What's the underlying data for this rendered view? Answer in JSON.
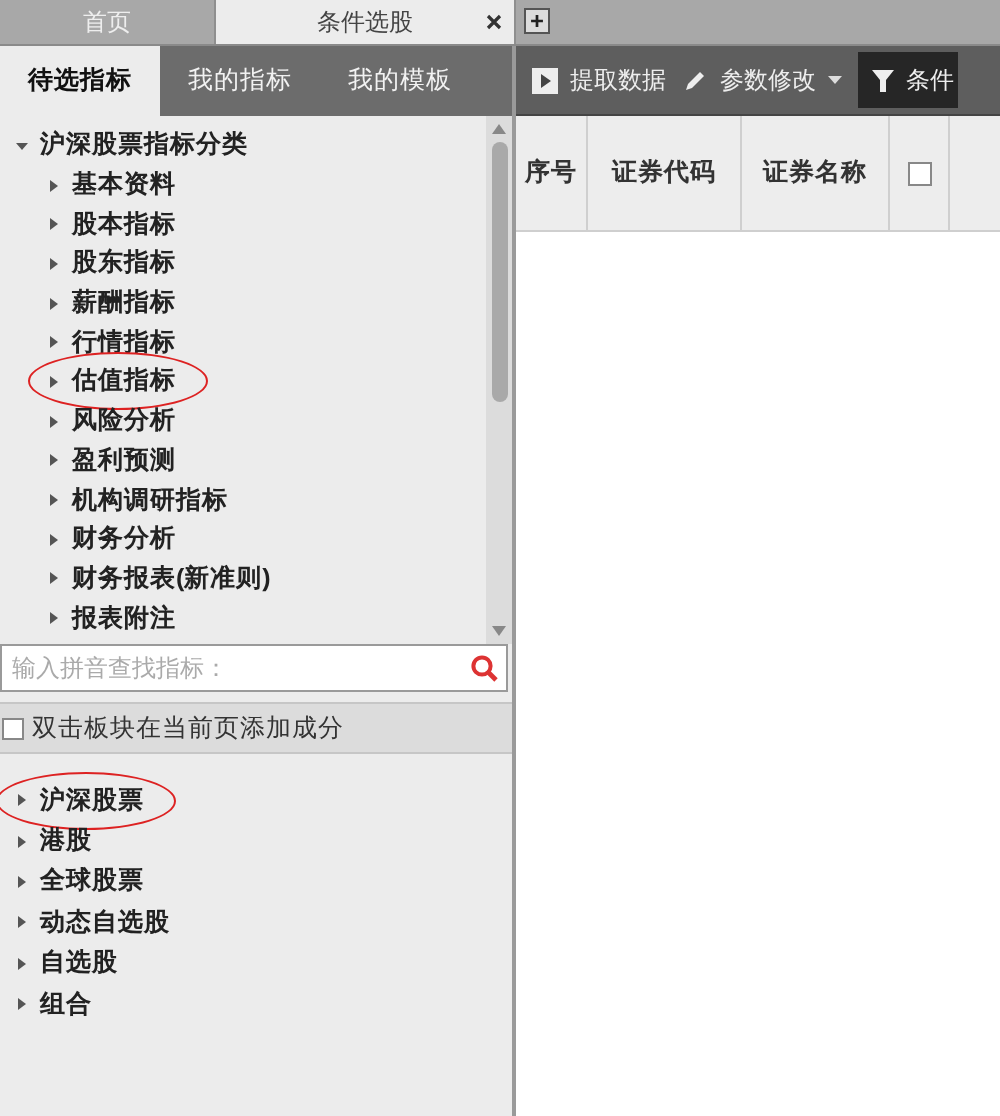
{
  "tabs": [
    {
      "label": "首页",
      "selected": false,
      "closable": false
    },
    {
      "label": "条件选股",
      "selected": true,
      "closable": true
    }
  ],
  "panel_tabs": [
    {
      "label": "待选指标",
      "selected": true
    },
    {
      "label": "我的指标",
      "selected": false
    },
    {
      "label": "我的模板",
      "selected": false
    }
  ],
  "indicator_tree": [
    {
      "label": "沪深股票指标分类",
      "expanded": true,
      "circled": false,
      "children": [
        {
          "label": "基本资料",
          "expanded": false,
          "circled": false
        },
        {
          "label": "股本指标",
          "expanded": false,
          "circled": false
        },
        {
          "label": "股东指标",
          "expanded": false,
          "circled": false
        },
        {
          "label": "薪酬指标",
          "expanded": false,
          "circled": false
        },
        {
          "label": "行情指标",
          "expanded": false,
          "circled": false
        },
        {
          "label": "估值指标",
          "expanded": false,
          "circled": true
        },
        {
          "label": "风险分析",
          "expanded": false,
          "circled": false
        },
        {
          "label": "盈利预测",
          "expanded": false,
          "circled": false
        },
        {
          "label": "机构调研指标",
          "expanded": false,
          "circled": false
        },
        {
          "label": "财务分析",
          "expanded": false,
          "circled": false
        },
        {
          "label": "财务报表(新准则)",
          "expanded": false,
          "circled": false
        },
        {
          "label": "报表附注",
          "expanded": false,
          "circled": false
        }
      ]
    }
  ],
  "search": {
    "placeholder": "输入拼音查找指标："
  },
  "add_components": {
    "label": "双击板块在当前页添加成分",
    "checked": false
  },
  "stock_tree": [
    {
      "label": "沪深股票",
      "expanded": false,
      "circled": true
    },
    {
      "label": "港股",
      "expanded": false,
      "circled": false
    },
    {
      "label": "全球股票",
      "expanded": false,
      "circled": false
    },
    {
      "label": "动态自选股",
      "expanded": false,
      "circled": false
    },
    {
      "label": "自选股",
      "expanded": false,
      "circled": false
    },
    {
      "label": "组合",
      "expanded": false,
      "circled": false
    }
  ],
  "toolbar": [
    {
      "kind": "run",
      "label": "提取数据"
    },
    {
      "kind": "menu",
      "label": "参数修改"
    },
    {
      "kind": "filter",
      "label": "条件"
    }
  ],
  "table": {
    "columns": [
      {
        "kind": "text",
        "label": "序号"
      },
      {
        "kind": "text",
        "label": "证券代码"
      },
      {
        "kind": "text",
        "label": "证券名称"
      },
      {
        "kind": "checkbox",
        "checked": false
      }
    ]
  }
}
